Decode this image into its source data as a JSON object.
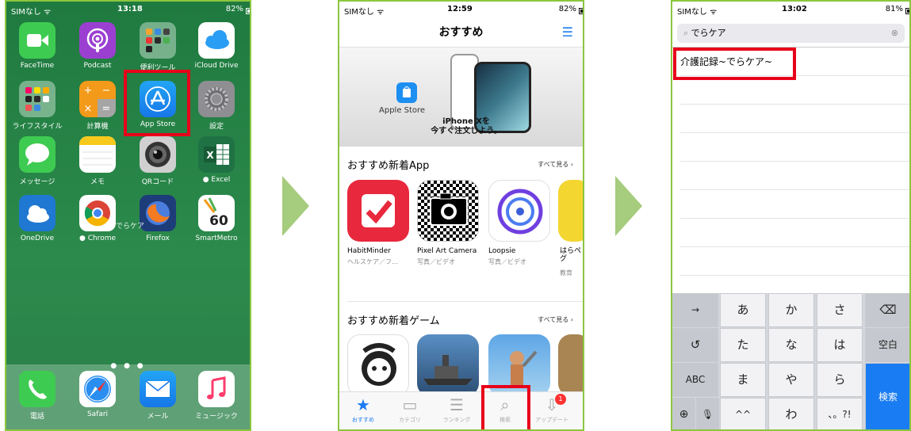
{
  "phone1": {
    "status": {
      "carrier": "SIMなし ᯤ",
      "time": "13:18",
      "battery": "82%"
    },
    "apps": [
      {
        "name": "FaceTime",
        "label": "FaceTime",
        "color": "#3ecb52"
      },
      {
        "name": "Podcast",
        "label": "Podcast",
        "color": "#9b3fd1"
      },
      {
        "name": "Folder",
        "label": "便利ツール",
        "color": "#7aa88e"
      },
      {
        "name": "iCloud",
        "label": "iCloud Drive",
        "color": "#ffffff"
      },
      {
        "name": "Lifestyle",
        "label": "ライフスタイル",
        "color": "#7aa88e"
      },
      {
        "name": "Calculator",
        "label": "計算機",
        "color": "#f39a1a"
      },
      {
        "name": "AppStore",
        "label": "App Store",
        "color": "#1d8ff2"
      },
      {
        "name": "Settings",
        "label": "設定",
        "color": "#8e8e93"
      },
      {
        "name": "Messages",
        "label": "メッセージ",
        "color": "#3ecb52"
      },
      {
        "name": "Notes",
        "label": "メモ",
        "color": "#ffffff"
      },
      {
        "name": "QR",
        "label": "QRコード",
        "color": "#cfcfcf"
      },
      {
        "name": "Excel",
        "label": "● Excel",
        "color": "#1f7244"
      },
      {
        "name": "OneDrive",
        "label": "OneDrive",
        "color": "#1f78d1"
      },
      {
        "name": "Chrome",
        "label": "● Chrome",
        "color": "#ffffff"
      },
      {
        "name": "Firefox",
        "label": "Firefox",
        "color": "#1d3c7a"
      },
      {
        "name": "SmartMetro",
        "label": "SmartMetro",
        "color": "#ffffff"
      }
    ],
    "dock": [
      {
        "name": "Phone",
        "label": "電話",
        "color": "#3ecb52"
      },
      {
        "name": "Safari",
        "label": "Safari",
        "color": "#ffffff"
      },
      {
        "name": "Mail",
        "label": "メール",
        "color": "#1d8ff2"
      },
      {
        "name": "Music",
        "label": "ミュージック",
        "color": "#ffffff"
      }
    ],
    "page_dots": "● ● ●",
    "overlay_text": "でらケア",
    "smartmetro_number": "60"
  },
  "phone2": {
    "status": {
      "carrier": "SIMなし ᯤ",
      "time": "12:59",
      "battery": "82%"
    },
    "title": "おすすめ",
    "banner": {
      "store_label": "Apple Store",
      "promo": "iPhone Xを\n今すぐ注文しよう。"
    },
    "section1": {
      "title": "おすすめ新着App",
      "see_all": "すべて見る ›",
      "apps": [
        {
          "name": "HabitMinder",
          "sub": "ヘルスケア／フ…"
        },
        {
          "name": "Pixel Art Camera",
          "sub": "写真／ビデオ"
        },
        {
          "name": "Loopsie",
          "sub": "写真／ビデオ"
        },
        {
          "name": "はらぺ\nグ",
          "sub": "教育"
        }
      ]
    },
    "section2": {
      "title": "おすすめ新着ゲーム",
      "see_all": "すべて見る ›"
    },
    "tabs": [
      {
        "label": "おすすめ",
        "icon": "★"
      },
      {
        "label": "カテゴリ",
        "icon": "▭"
      },
      {
        "label": "ランキング",
        "icon": "☰"
      },
      {
        "label": "検索",
        "icon": "⌕"
      },
      {
        "label": "アップデート",
        "icon": "⇩"
      }
    ],
    "update_badge": "1"
  },
  "phone3": {
    "status": {
      "carrier": "SIMなし ᯤ",
      "time": "13:02",
      "battery": "81%"
    },
    "search": {
      "value": "でらケア",
      "clear": "⊗"
    },
    "result": "介護記録~でらケア~",
    "keys": {
      "row1": [
        "→",
        "あ",
        "か",
        "さ",
        "⌫"
      ],
      "row2": [
        "↺",
        "た",
        "な",
        "は",
        "空白"
      ],
      "row3": [
        "ABC",
        "ま",
        "や",
        "ら",
        "検索"
      ],
      "row4": [
        "⊕",
        "🎙",
        "^^",
        "わ",
        "、。?!"
      ]
    }
  }
}
